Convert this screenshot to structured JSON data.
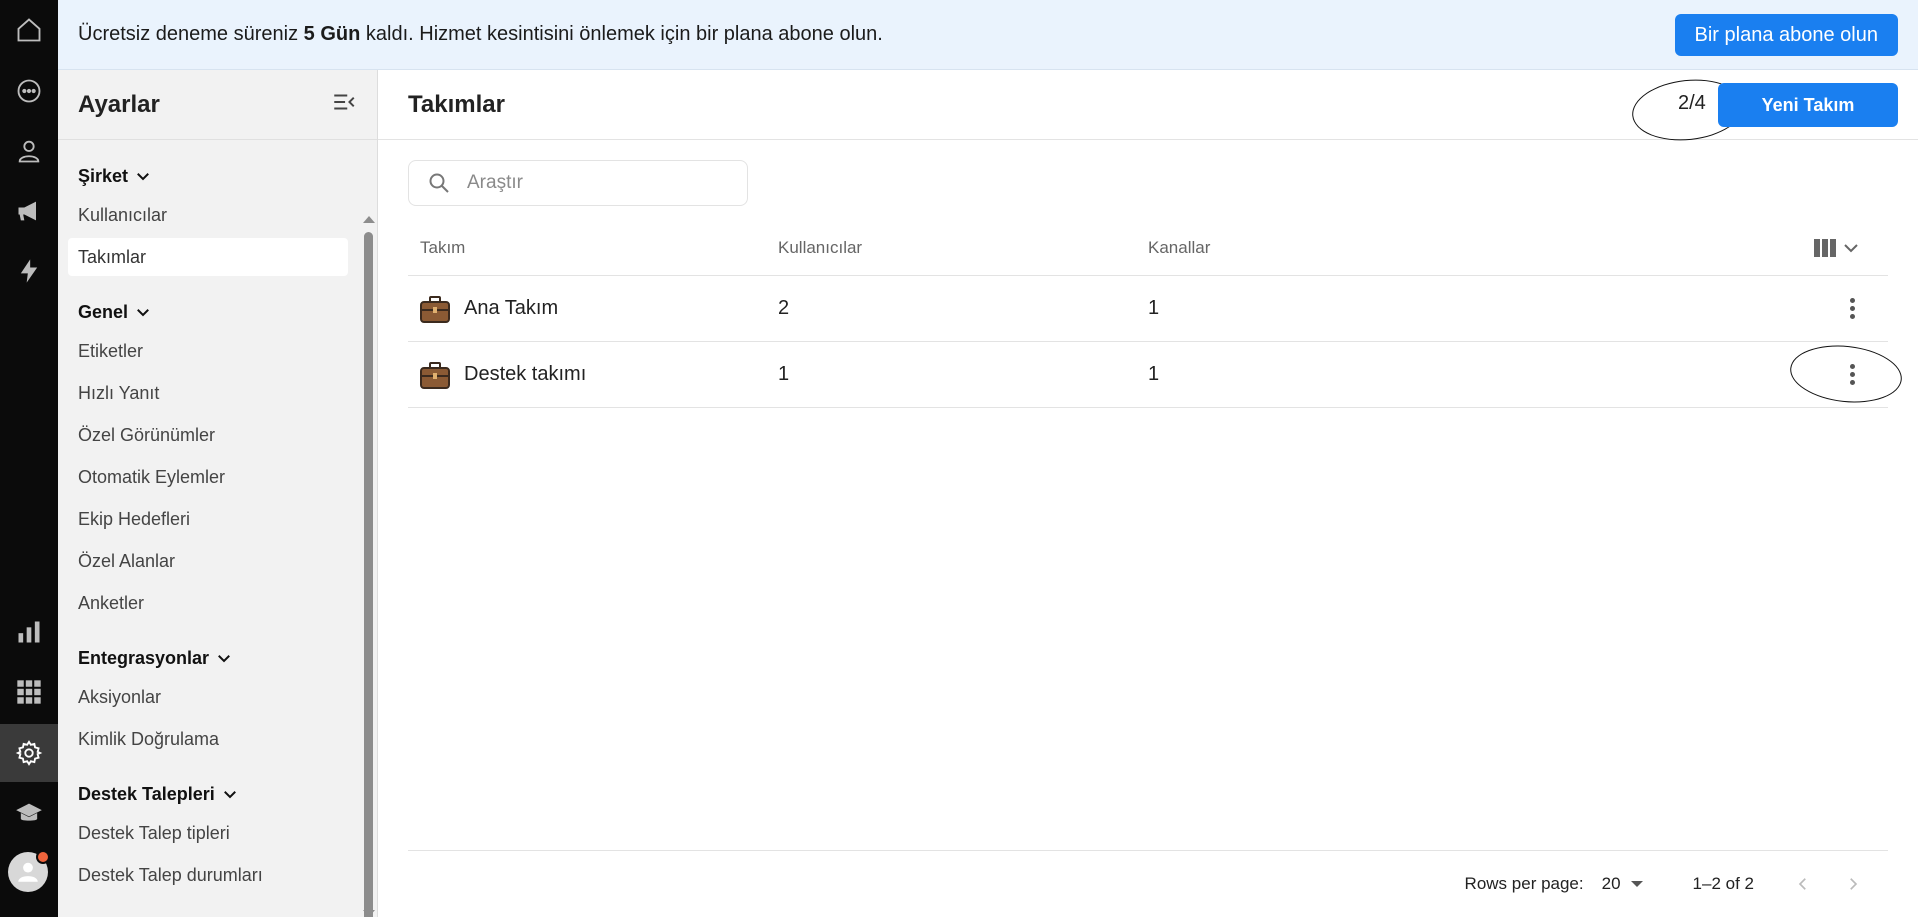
{
  "rail": {
    "icons": [
      "home-icon",
      "chat-icon",
      "contacts-icon",
      "megaphone-icon",
      "bolt-icon",
      "reports-icon",
      "apps-icon",
      "settings-icon",
      "academy-icon",
      "user-avatar"
    ]
  },
  "banner": {
    "text_before": "Ücretsiz deneme süreniz ",
    "text_bold": "5 Gün",
    "text_after": " kaldı. Hizmet kesintisini önlemek için bir plana abone olun.",
    "button": "Bir plana abone olun"
  },
  "sidebar": {
    "title": "Ayarlar",
    "sections": [
      {
        "label": "Şirket",
        "items": [
          "Kullanıcılar",
          "Takımlar"
        ]
      },
      {
        "label": "Genel",
        "items": [
          "Etiketler",
          "Hızlı Yanıt",
          "Özel Görünümler",
          "Otomatik Eylemler",
          "Ekip Hedefleri",
          "Özel Alanlar",
          "Anketler"
        ]
      },
      {
        "label": "Entegrasyonlar",
        "items": [
          "Aksiyonlar",
          "Kimlik Doğrulama"
        ]
      },
      {
        "label": "Destek Talepleri",
        "items": [
          "Destek Talep tipleri",
          "Destek Talep durumları"
        ]
      }
    ],
    "active_item": "Takımlar"
  },
  "main": {
    "title": "Takımlar",
    "counter": "2/4",
    "new_button": "Yeni Takım",
    "search_placeholder": "Araştır",
    "columns": [
      "Takım",
      "Kullanıcılar",
      "Kanallar"
    ],
    "rows": [
      {
        "name": "Ana Takım",
        "users": "2",
        "channels": "1"
      },
      {
        "name": "Destek takımı",
        "users": "1",
        "channels": "1"
      }
    ],
    "footer": {
      "rows_per_page_label": "Rows per page:",
      "rows_per_page_value": "20",
      "range": "1–2 of 2"
    }
  },
  "colors": {
    "accent": "#1a7ff0",
    "banner_bg": "#eaf3fd",
    "rail_bg": "#0b0b0b",
    "sidebar_bg": "#f2f2f2"
  }
}
